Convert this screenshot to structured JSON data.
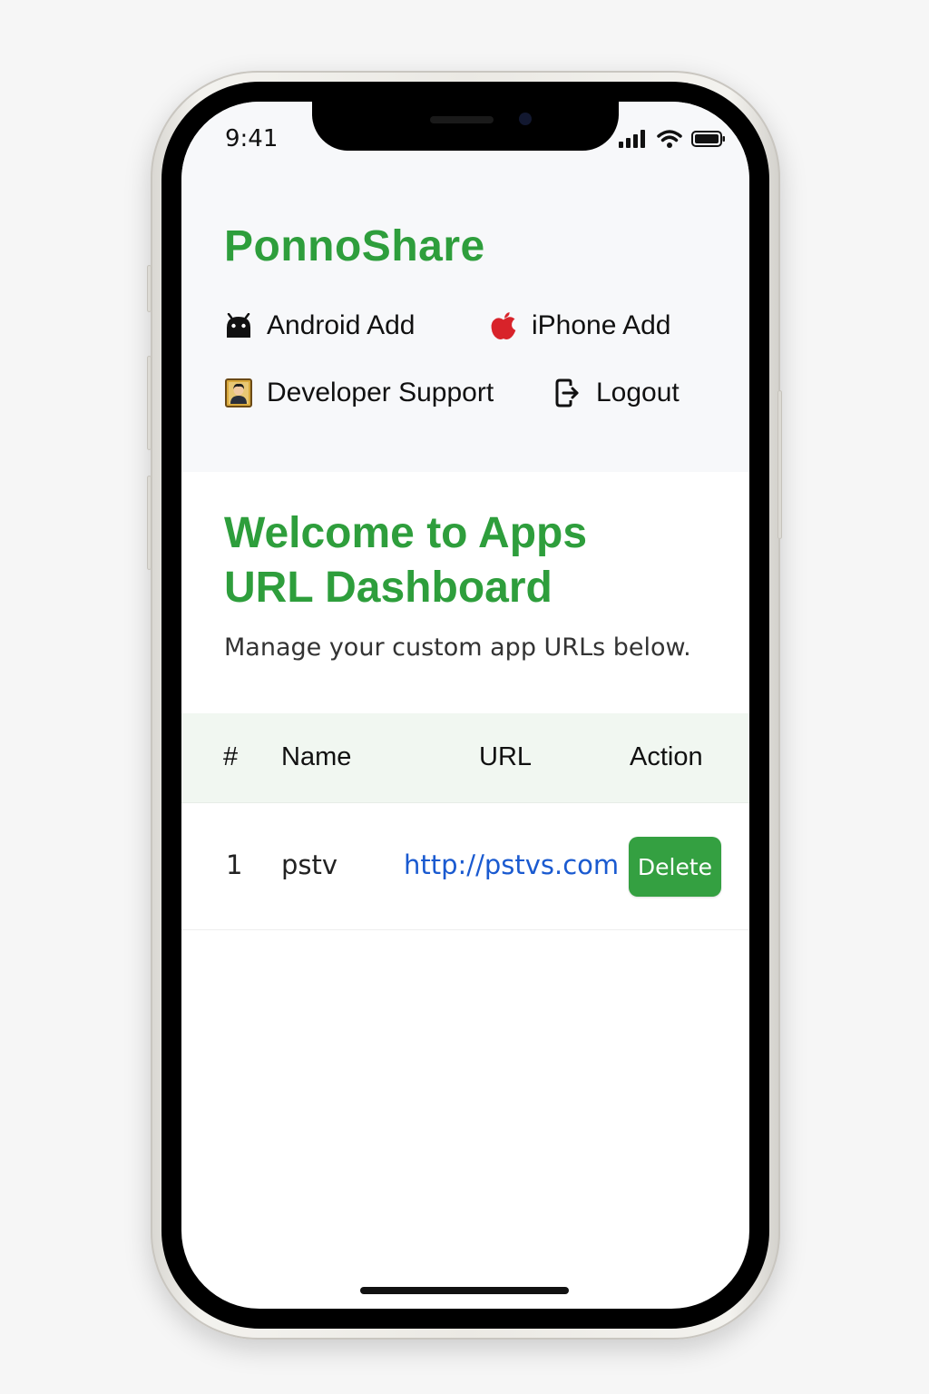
{
  "status_bar": {
    "time": "9:41"
  },
  "brand": {
    "name": "PonnoShare",
    "color": "#2e9e3c"
  },
  "nav": {
    "android_add": "Android Add",
    "iphone_add": "iPhone Add",
    "developer_support": "Developer Support",
    "logout": "Logout"
  },
  "main": {
    "welcome_line1": "Welcome to Apps",
    "welcome_line2": "URL Dashboard",
    "subtitle": "Manage your custom app URLs below."
  },
  "table": {
    "headers": [
      "#",
      "Name",
      "URL",
      "Action"
    ],
    "rows": [
      {
        "index": "1",
        "name": "pstv",
        "url": "http://pstvs.com",
        "action": "Delete"
      }
    ]
  },
  "icons": {
    "android": "android-icon",
    "apple": "apple-icon",
    "developer": "developer-portrait-icon",
    "logout": "logout-icon",
    "signal": "signal-icon",
    "wifi": "wifi-icon",
    "battery": "battery-icon"
  },
  "colors": {
    "accent": "#2e9e3c",
    "button": "#34a041",
    "link": "#1a5ad0",
    "table_header_bg": "#f1f7f1"
  }
}
